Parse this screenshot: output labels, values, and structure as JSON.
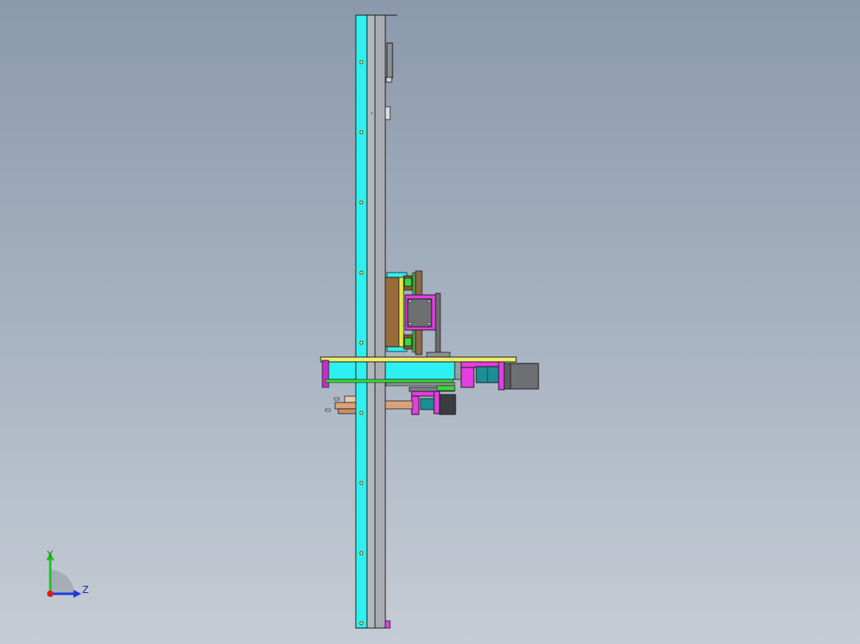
{
  "view": {
    "background_top": "#8a99ac",
    "background_bottom": "#c6ccd5"
  },
  "triad": {
    "y_label": "Y",
    "z_label": "Z",
    "y_color": "#1ec31e",
    "z_color": "#1e3cd8",
    "x_color": "#d81e1e"
  },
  "colors": {
    "rail_cyan": "#2ff0f0",
    "rail_gray": "#a9acb0",
    "plate_yellow": "#f0f06a",
    "bracket_magenta": "#e23ee2",
    "motor_gray": "#6e6f73",
    "coupling_teal": "#1b8f95",
    "pad_green": "#3bd63b",
    "slider_brown": "#9a6b3a",
    "rod_copper": "#d9a27a"
  }
}
